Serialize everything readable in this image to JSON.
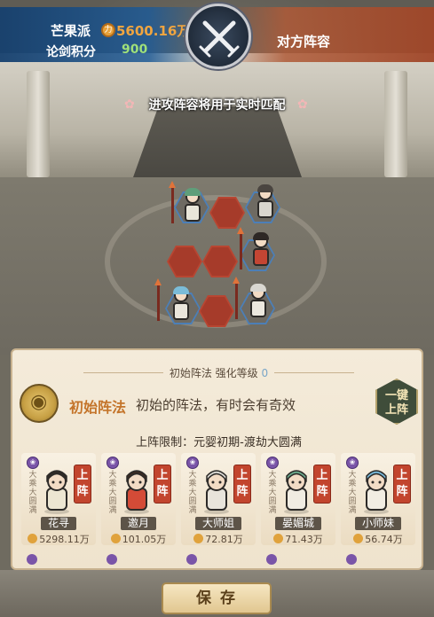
{
  "header": {
    "team_name": "芒果派",
    "power": "5600.16万",
    "score_label": "论剑积分",
    "score_value": "900",
    "opponent_label": "对方阵容",
    "notice": "进攻阵容将用于实时匹配",
    "emblem_icon": "crossed-swords-icon"
  },
  "panel": {
    "title": "初始阵法 强化等级",
    "level": "0",
    "formation_name": "初始阵法",
    "formation_desc": "初始的阵法，有时会有奇效",
    "one_click_label": [
      "一键",
      "上阵"
    ],
    "restriction": "上阵限制：元婴初期-渡劫大圆满",
    "cards": [
      {
        "name": "花寻",
        "power": "5298.11万",
        "realm": "大乘大圆满",
        "deploy": "上阵",
        "hair": "#2f2a26",
        "robe": "#ece6d2"
      },
      {
        "name": "邀月",
        "power": "101.05万",
        "realm": "大乘大圆满",
        "deploy": "上阵",
        "hair": "#3a2b22",
        "robe": "#d44b37"
      },
      {
        "name": "大师姐",
        "power": "72.81万",
        "realm": "大乘大圆满",
        "deploy": "上阵",
        "hair": "#dad8d2",
        "robe": "#e8e4db"
      },
      {
        "name": "晏媚城",
        "power": "71.43万",
        "realm": "大乘大圆满",
        "deploy": "上阵",
        "hair": "#6aa88a",
        "robe": "#f0ece2"
      },
      {
        "name": "小师妹",
        "power": "56.74万",
        "realm": "大乘大圆满",
        "deploy": "上阵",
        "hair": "#78b8d8",
        "robe": "#f1ede3"
      }
    ]
  },
  "footer": {
    "save_label": "保存"
  },
  "colors": {
    "ally_banner": "#1e5a96",
    "enemy_banner": "#af5a37",
    "power_text": "#f0a540",
    "score_text": "#9fe07a",
    "deploy_button": "#c2452e"
  }
}
